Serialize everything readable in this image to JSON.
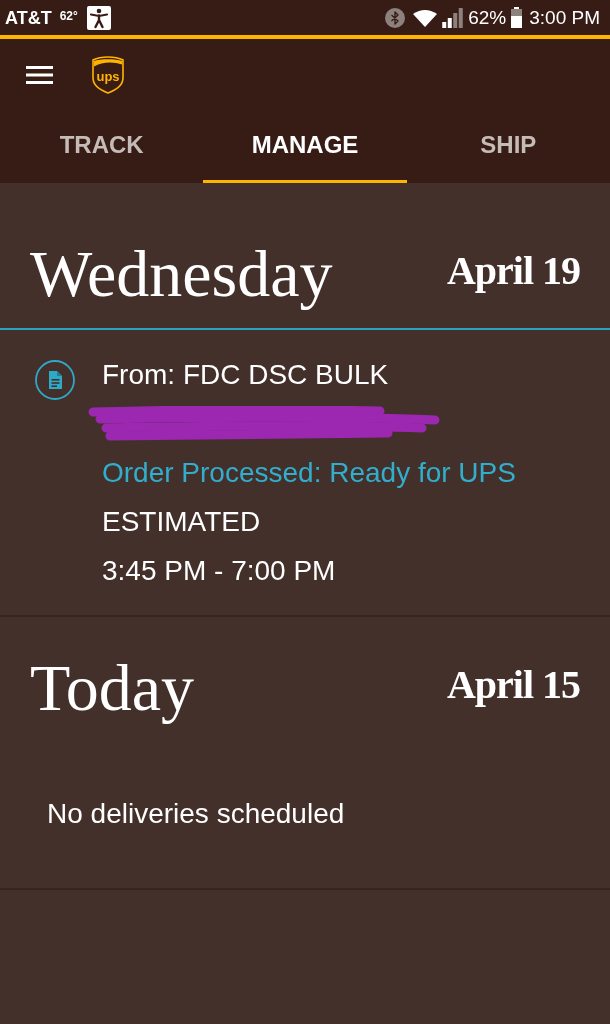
{
  "status_bar": {
    "carrier": "AT&T",
    "temperature": "62°",
    "battery_percent": "62%",
    "time": "3:00 PM"
  },
  "app_bar": {
    "logo_text": "ups"
  },
  "tabs": [
    {
      "label": "TRACK",
      "selected": false
    },
    {
      "label": "MANAGE",
      "selected": true
    },
    {
      "label": "SHIP",
      "selected": false
    }
  ],
  "days": [
    {
      "day": "Wednesday",
      "date": "April 19",
      "shipments": [
        {
          "from": "From: FDC DSC BULK",
          "redacted": true,
          "status": "Order Processed: Ready for UPS",
          "estimate_label": "ESTIMATED",
          "time_window": "3:45 PM - 7:00 PM"
        }
      ]
    },
    {
      "day": "Today",
      "date": "April 15",
      "empty_message": "No deliveries scheduled"
    }
  ]
}
